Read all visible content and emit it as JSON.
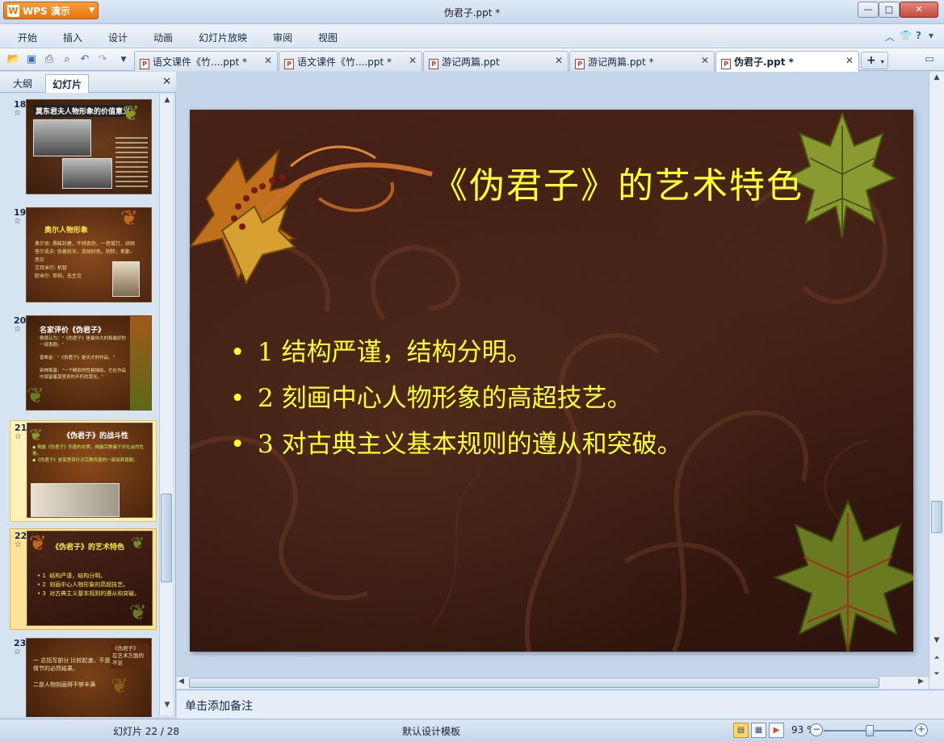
{
  "app": {
    "name": "WPS 演示",
    "doc_title": "伪君子.ppt *",
    "window_controls": {
      "minimize": "—",
      "maximize": "□",
      "close": "✕"
    }
  },
  "menu": {
    "items": [
      "开始",
      "插入",
      "设计",
      "动画",
      "幻灯片放映",
      "审阅",
      "视图"
    ],
    "right_icons": [
      "collapse-icon",
      "skin-icon",
      "help-icon"
    ]
  },
  "doc_tabs": [
    {
      "label": "语文课件《竹....ppt *"
    },
    {
      "label": "语文课件《竹....ppt *"
    },
    {
      "label": "游记两篇.ppt"
    },
    {
      "label": "游记两篇.ppt *"
    },
    {
      "label": "伪君子.ppt *"
    }
  ],
  "left_panel": {
    "tabs": [
      "大纲",
      "幻灯片"
    ],
    "thumbnails": [
      {
        "num": "18",
        "title": "莫东君夫人物形象的价值意义"
      },
      {
        "num": "19",
        "title": "奥尔人物形象",
        "body": "奥尔贡: 愚昧封建，不辨真伪，一意孤行，顽固\n答尔丢夫: 伪善狡诈，贪财好色，阴险，卑鄙，恶劣\n艾耳米尔: 机智\n欧米尔: 单纯，无主见"
      },
      {
        "num": "20",
        "title": "名家评价《伪君子》",
        "body": "歌德认为：\"《伪君子》是最伟大的和最好的一部喜剧。\"\n\n普希金：\"《伪君子》是天才的作品。\"\n\n别林斯基：\"一个精彩的性格描绘，它在作品中保留着莫里哀的不朽的荣光。\""
      },
      {
        "num": "21",
        "title": "《伪君子》的战斗性",
        "body": "◆ 揭露《伪君子》伪善的本质，揭露宗教骗子对社会的危害。\n◆《伪君子》是莫里哀针对宗教伪善的一部讽刺喜剧。"
      },
      {
        "num": "22",
        "title": "《伪君子》的艺术特色",
        "body": "• 1  结构严谨，结构分明。\n• 2  刻画中心人物形象的高超技艺。\n• 3  对古典主义基本规则的遵从和突破。"
      },
      {
        "num": "23",
        "title": "",
        "body": "一 总括写部分 比较起速，不是情节的必然结果。\n\n二是人物刻画得不够丰满",
        "side": "《伪君子》\n在艺术方面的不足"
      }
    ]
  },
  "slide": {
    "title": "《伪君子》的艺术特色",
    "bullets": [
      "1  结构严谨，结构分明。",
      "2  刻画中心人物形象的高超技艺。",
      "3  对古典主义基本规则的遵从和突破。"
    ],
    "bullet_symbol": "•",
    "title_color": "#ffff2e"
  },
  "notes": {
    "placeholder": "单击添加备注"
  },
  "status": {
    "slide_counter": "幻灯片 22 / 28",
    "template": "默认设计模板",
    "zoom": "93 %"
  }
}
